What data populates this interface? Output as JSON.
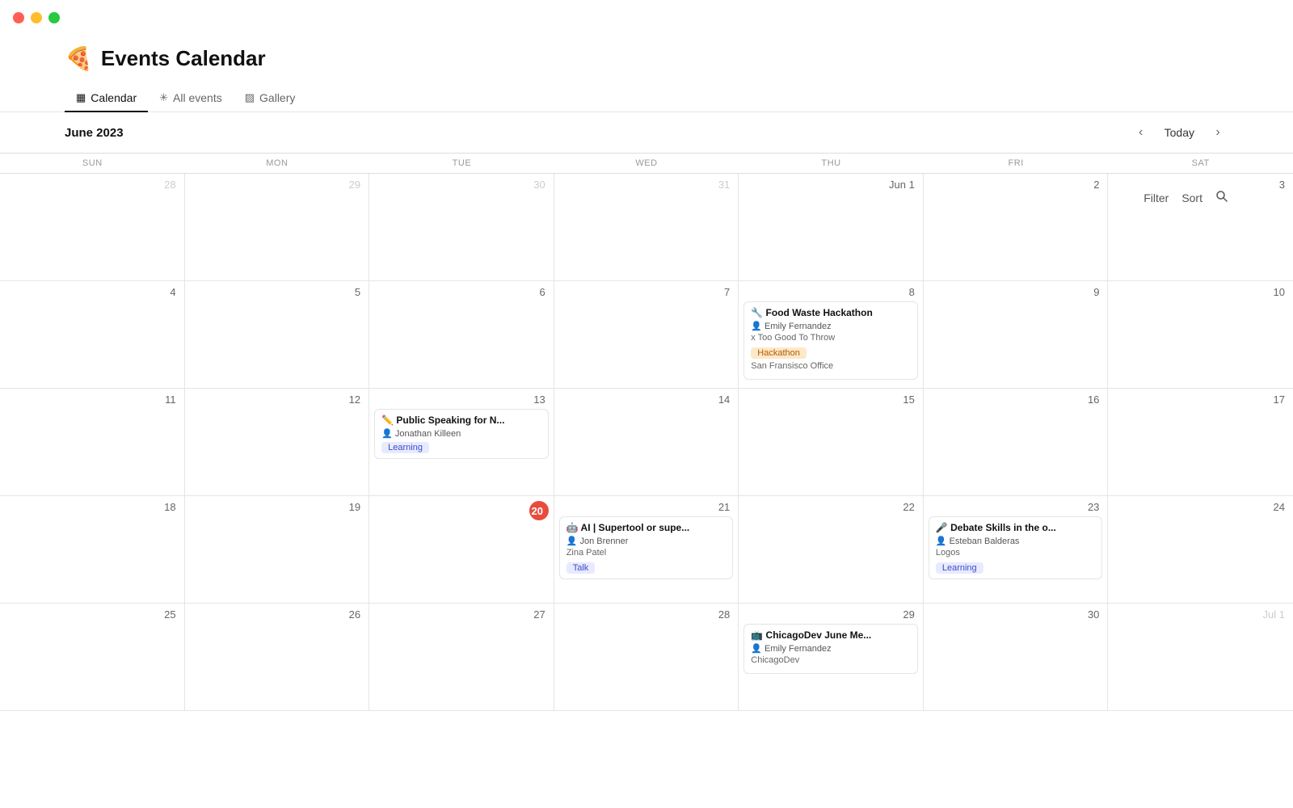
{
  "titlebar": {
    "dots": [
      "red",
      "yellow",
      "green"
    ]
  },
  "header": {
    "icon": "🍕",
    "title": "Events Calendar"
  },
  "tabs": [
    {
      "id": "calendar",
      "icon": "▦",
      "label": "Calendar",
      "active": true
    },
    {
      "id": "all-events",
      "icon": "✳",
      "label": "All events",
      "active": false
    },
    {
      "id": "gallery",
      "icon": "▨",
      "label": "Gallery",
      "active": false
    }
  ],
  "toolbar": {
    "filter_label": "Filter",
    "sort_label": "Sort",
    "search_label": "🔍"
  },
  "calendar": {
    "month_title": "June 2023",
    "today_label": "Today",
    "day_headers": [
      "Sun",
      "Mon",
      "Tue",
      "Wed",
      "Thu",
      "Fri",
      "Sat"
    ],
    "weeks": [
      {
        "days": [
          {
            "number": "28",
            "other_month": true,
            "events": []
          },
          {
            "number": "29",
            "other_month": true,
            "events": []
          },
          {
            "number": "30",
            "other_month": true,
            "events": []
          },
          {
            "number": "31",
            "other_month": true,
            "events": []
          },
          {
            "number": "Jun 1",
            "events": []
          },
          {
            "number": "2",
            "events": []
          },
          {
            "number": "3",
            "events": []
          }
        ]
      },
      {
        "days": [
          {
            "number": "4",
            "events": []
          },
          {
            "number": "5",
            "events": []
          },
          {
            "number": "6",
            "events": []
          },
          {
            "number": "7",
            "events": []
          },
          {
            "number": "8",
            "events": [
              {
                "icon": "🔧",
                "title": "Food Waste Hackathon",
                "person": "Emily Fernandez",
                "person_icon": "👤",
                "meta": "x Too Good To Throw",
                "tag": "Hackathon",
                "tag_class": "tag-hackathon",
                "location": "San Fransisco Office"
              }
            ]
          },
          {
            "number": "9",
            "events": []
          },
          {
            "number": "10",
            "events": []
          }
        ]
      },
      {
        "days": [
          {
            "number": "11",
            "events": []
          },
          {
            "number": "12",
            "events": []
          },
          {
            "number": "13",
            "events": [
              {
                "icon": "✏️",
                "title": "Public Speaking for N...",
                "person": "Jonathan Killeen",
                "person_icon": "👤",
                "meta": "",
                "tag": "Learning",
                "tag_class": "tag-learning"
              }
            ]
          },
          {
            "number": "14",
            "events": []
          },
          {
            "number": "15",
            "events": []
          },
          {
            "number": "16",
            "events": []
          },
          {
            "number": "17",
            "events": []
          }
        ]
      },
      {
        "days": [
          {
            "number": "18",
            "events": []
          },
          {
            "number": "19",
            "events": []
          },
          {
            "number": "20",
            "today": true,
            "events": []
          },
          {
            "number": "21",
            "events": [
              {
                "icon": "🤖",
                "title": "AI | Supertool or supe...",
                "person": "Jon Brenner",
                "person_icon": "👤",
                "meta": "Zina Patel",
                "tag": "Talk",
                "tag_class": "tag-talk"
              }
            ]
          },
          {
            "number": "22",
            "events": []
          },
          {
            "number": "23",
            "events": [
              {
                "icon": "🎤",
                "title": "Debate Skills in the o...",
                "person": "Esteban Balderas",
                "person_icon": "👤",
                "meta": "Logos",
                "tag": "Learning",
                "tag_class": "tag-learning2"
              }
            ]
          },
          {
            "number": "24",
            "events": []
          }
        ]
      },
      {
        "days": [
          {
            "number": "25",
            "events": []
          },
          {
            "number": "26",
            "events": []
          },
          {
            "number": "27",
            "events": []
          },
          {
            "number": "28",
            "events": []
          },
          {
            "number": "29",
            "events": [
              {
                "icon": "📺",
                "title": "ChicagoDev June Me...",
                "person": "Emily Fernandez",
                "person_icon": "👤",
                "meta": "ChicagoDev",
                "tag": "",
                "tag_class": ""
              }
            ]
          },
          {
            "number": "30",
            "events": []
          },
          {
            "number": "Jul 1",
            "other_month": true,
            "events": []
          }
        ]
      }
    ]
  }
}
